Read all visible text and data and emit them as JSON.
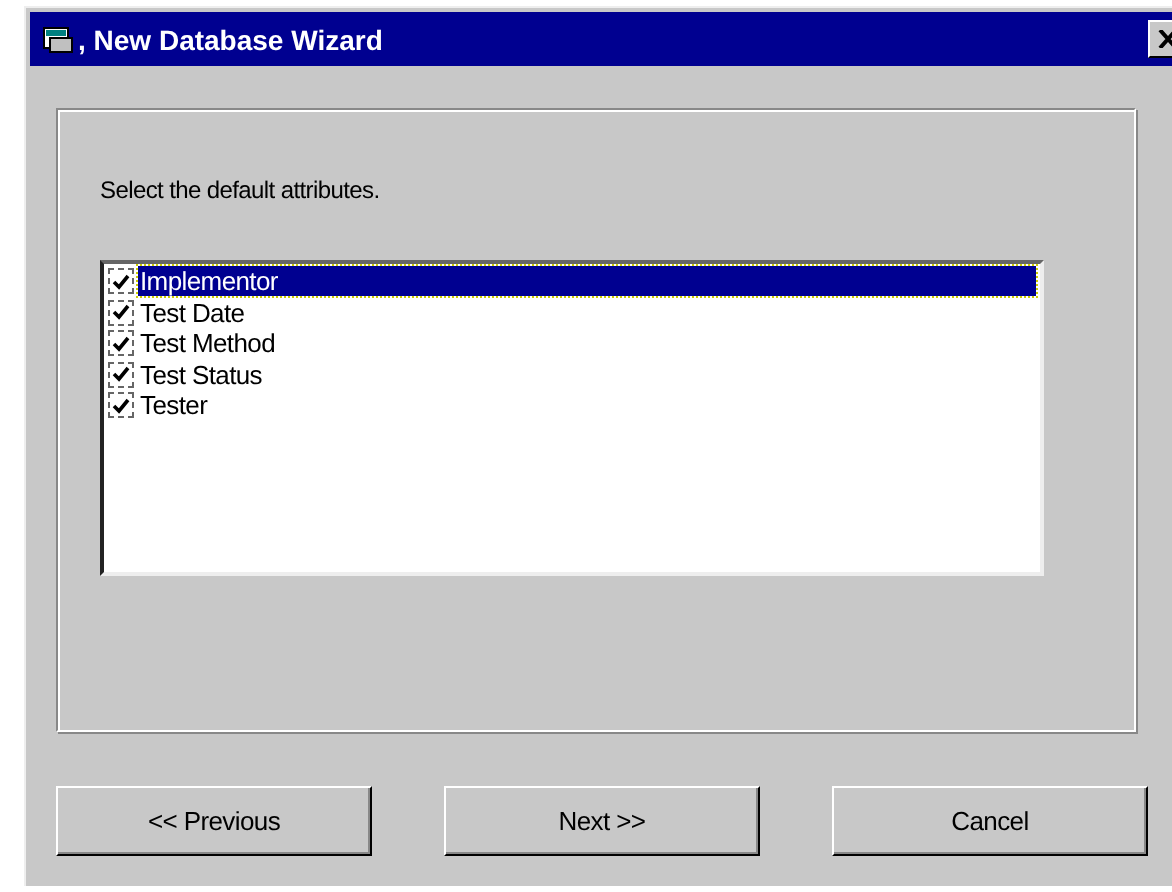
{
  "window": {
    "title": ", New Database Wizard"
  },
  "prompt": "Select the default attributes.",
  "attributes": [
    {
      "label": "Implementor",
      "checked": true,
      "selected": true
    },
    {
      "label": "Test Date",
      "checked": true,
      "selected": false
    },
    {
      "label": "Test Method",
      "checked": true,
      "selected": false
    },
    {
      "label": "Test Status",
      "checked": true,
      "selected": false
    },
    {
      "label": "Tester",
      "checked": true,
      "selected": false
    }
  ],
  "buttons": [
    "<< Previous",
    "Next >>",
    "Cancel"
  ]
}
